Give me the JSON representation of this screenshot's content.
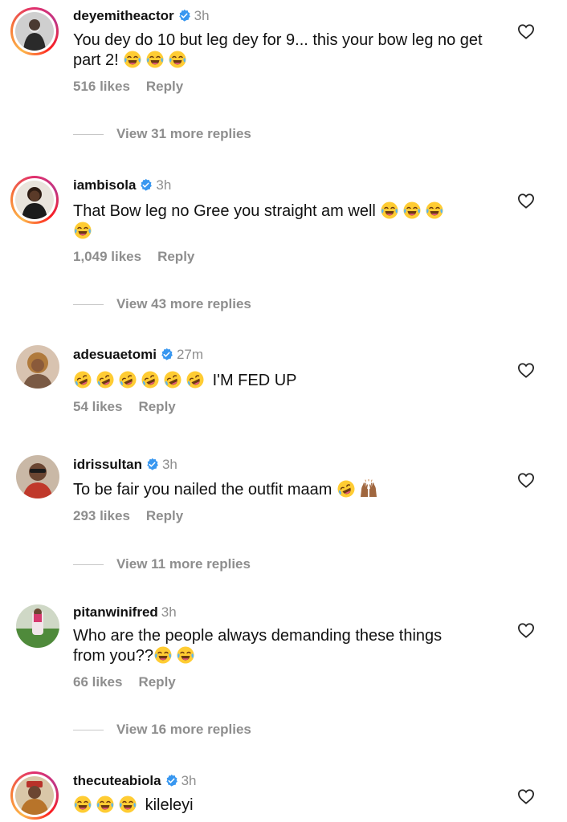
{
  "colors": {
    "verified": "#3897f0",
    "muted": "#8e8e8e",
    "text": "#111111"
  },
  "comments": [
    {
      "username": "deyemitheactor",
      "verified": true,
      "time": "3h",
      "text": "You dey do 10 but leg dey for 9... this your bow leg no get part 2!",
      "emojis": [
        "face-with-tears-of-joy",
        "face-with-tears-of-joy",
        "face-with-tears-of-joy"
      ],
      "likes": "516 likes",
      "reply": "Reply",
      "view_replies": "View 31 more replies"
    },
    {
      "username": "iambisola",
      "verified": true,
      "time": "3h",
      "text": "That Bow leg no Gree you straight am well",
      "emojis": [
        "face-with-tears-of-joy",
        "face-with-tears-of-joy",
        "face-with-tears-of-joy",
        "face-with-tears-of-joy"
      ],
      "likes": "1,049 likes",
      "reply": "Reply",
      "view_replies": "View 43 more replies"
    },
    {
      "username": "adesuaetomi",
      "verified": true,
      "time": "27m",
      "text": "I'M FED UP",
      "emojis": [
        "rolling-on-floor-laughing",
        "rolling-on-floor-laughing",
        "rolling-on-floor-laughing",
        "rolling-on-floor-laughing",
        "rolling-on-floor-laughing",
        "rolling-on-floor-laughing"
      ],
      "likes": "54 likes",
      "reply": "Reply"
    },
    {
      "username": "idrissultan",
      "verified": true,
      "time": "3h",
      "text": "To be fair you nailed the outfit maam",
      "emojis": [
        "rolling-on-floor-laughing",
        "raising-hands"
      ],
      "likes": "293 likes",
      "reply": "Reply",
      "view_replies": "View 11 more replies"
    },
    {
      "username": "pitanwinifred",
      "verified": false,
      "time": "3h",
      "text_line1": "Who are the people always demanding these things",
      "text_line2": "from you??",
      "emojis": [
        "face-with-tears-of-joy",
        "face-with-tears-of-joy"
      ],
      "likes": "66 likes",
      "reply": "Reply",
      "view_replies": "View 16 more replies"
    },
    {
      "username": "thecuteabiola",
      "verified": true,
      "time": "3h",
      "text": "kileleyi",
      "emojis": [
        "face-with-tears-of-joy",
        "face-with-tears-of-joy",
        "face-with-tears-of-joy"
      ]
    }
  ]
}
